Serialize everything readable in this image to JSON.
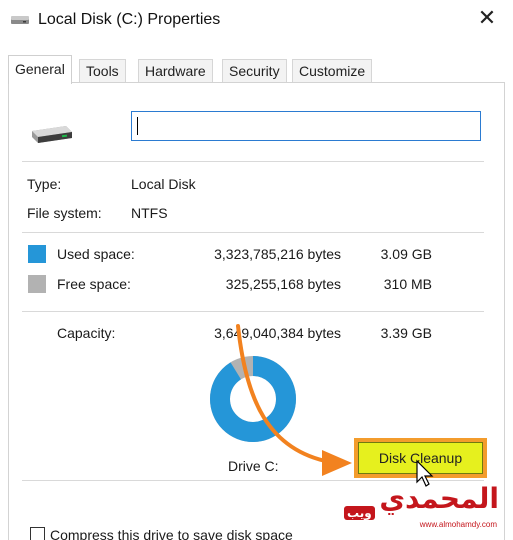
{
  "window": {
    "title": "Local Disk (C:) Properties",
    "close_glyph": "✕",
    "title_icon": "drive-properties-icon"
  },
  "tabs": [
    {
      "label": "General",
      "active": true
    },
    {
      "label": "Tools",
      "active": false
    },
    {
      "label": "Hardware",
      "active": false
    },
    {
      "label": "Security",
      "active": false
    },
    {
      "label": "Customize",
      "active": false
    }
  ],
  "general": {
    "drive_icon": "hard-drive-icon",
    "name_value": "",
    "type_label": "Type:",
    "type_value": "Local Disk",
    "fs_label": "File system:",
    "fs_value": "NTFS",
    "used": {
      "label": "Used space:",
      "bytes": "3,323,785,216 bytes",
      "size": "3.09 GB",
      "color": "#2596d8"
    },
    "free": {
      "label": "Free space:",
      "bytes": "325,255,168 bytes",
      "size": "310 MB",
      "color": "#b2b2b2"
    },
    "capacity": {
      "label": "Capacity:",
      "bytes": "3,649,040,384 bytes",
      "size": "3.39 GB"
    },
    "used_fraction": 0.911,
    "drive_label": "Drive C:",
    "cleanup_label": "Disk Cleanup",
    "compress_label": "Compress this drive to save disk space",
    "compress_checked": false
  },
  "overlay": {
    "arrow_color": "#f2821f",
    "highlight_color": "#f39c2c",
    "button_highlight": "#e6f01e",
    "watermark_text": "المحمدي",
    "watermark_sub": "www.almohamdy.com",
    "watermark_badge": "ويب",
    "watermark_color": "#c4161c"
  }
}
